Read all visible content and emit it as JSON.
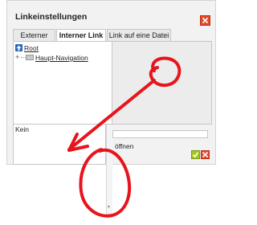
{
  "dialog": {
    "title": "Linkeinstellungen",
    "close_icon": "close-icon"
  },
  "tabs": [
    {
      "label": "Externer Link",
      "active": false
    },
    {
      "label": "Interner Link",
      "active": true
    },
    {
      "label": "Link auf eine Datei",
      "active": false
    }
  ],
  "tree": {
    "root": {
      "label": "Root",
      "icon": "root-icon"
    },
    "children": [
      {
        "label": "Haupt-Navigation",
        "icon": "folder-icon",
        "expand_icon": "plus-icon"
      }
    ]
  },
  "selection": {
    "label": "Kein"
  },
  "form": {
    "input_value": "",
    "open_label": "öffnen"
  },
  "actions": {
    "ok_icon": "checkmark-icon",
    "cancel_icon": "close-icon"
  },
  "colors": {
    "accent_red": "#e24a2c",
    "accent_green": "#a2c721",
    "annotation_red": "#e8141c",
    "root_blue": "#2a66b8"
  }
}
